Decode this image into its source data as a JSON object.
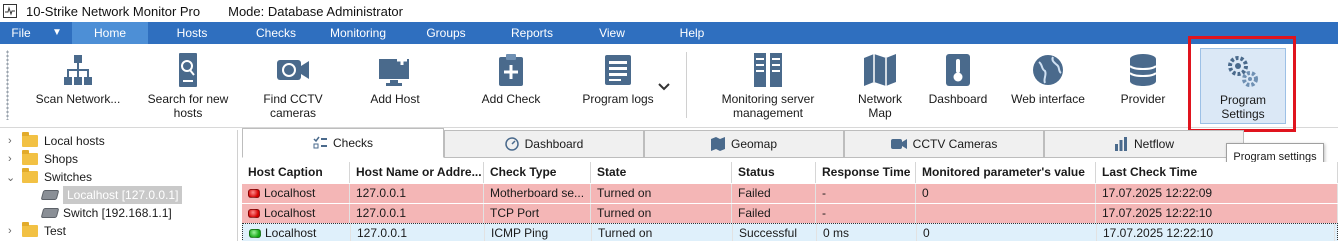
{
  "window": {
    "app_title": "10-Strike Network Monitor Pro",
    "mode_label": "Mode: Database Administrator"
  },
  "menu": {
    "items": [
      "File",
      "Home",
      "Hosts",
      "Checks",
      "Monitoring",
      "Groups",
      "Reports",
      "View",
      "Help"
    ],
    "active": "Home"
  },
  "ribbon": {
    "buttons": [
      {
        "label": "Scan Network...",
        "icon": "network-tree-icon"
      },
      {
        "label": "Search for new hosts",
        "icon": "search-server-icon"
      },
      {
        "label": "Find CCTV cameras",
        "icon": "cctv-camera-icon"
      },
      {
        "label": "Add Host",
        "icon": "add-host-monitor-icon"
      },
      {
        "label": "Add Check",
        "icon": "clipboard-plus-icon"
      },
      {
        "label": "Program logs",
        "icon": "log-list-icon"
      },
      {
        "label": "Monitoring server management",
        "icon": "server-rack-icon"
      },
      {
        "label": "Network Map",
        "icon": "map-icon"
      },
      {
        "label": "Dashboard",
        "icon": "thermometer-icon"
      },
      {
        "label": "Web interface",
        "icon": "globe-icon"
      },
      {
        "label": "Provider",
        "icon": "database-icon"
      },
      {
        "label": "Program Settings",
        "icon": "gears-icon"
      }
    ],
    "colors": {
      "icon_primary": "#4a6a8c",
      "icon_secondary": "#6f90b3",
      "highlight_border": "#e0141e"
    }
  },
  "tooltip": {
    "text": "Program settings"
  },
  "tree": {
    "nodes": [
      {
        "label": "Local hosts",
        "type": "folder"
      },
      {
        "label": "Shops",
        "type": "folder"
      },
      {
        "label": "Switches",
        "type": "folder"
      },
      {
        "label": "Localhost [127.0.0.1]",
        "type": "device",
        "selected": true
      },
      {
        "label": "Switch [192.168.1.1]",
        "type": "device"
      },
      {
        "label": "Test",
        "type": "folder"
      }
    ]
  },
  "tabs": {
    "items": [
      {
        "label": "Checks",
        "icon": "checklist-icon"
      },
      {
        "label": "Dashboard",
        "icon": "gauge-icon"
      },
      {
        "label": "Geomap",
        "icon": "geomap-icon"
      },
      {
        "label": "CCTV Cameras",
        "icon": "video-camera-icon"
      },
      {
        "label": "Netflow",
        "icon": "bar-chart-icon"
      }
    ],
    "active": "Checks"
  },
  "grid": {
    "columns": [
      "Host Caption",
      "Host Name or Addre...",
      "Check Type",
      "State",
      "Status",
      "Response Time",
      "Monitored parameter's value",
      "Last Check Time"
    ],
    "rows": [
      {
        "led": "red",
        "cells": [
          "Localhost",
          "127.0.0.1",
          "Motherboard se...",
          "Turned on",
          "Failed",
          "-",
          "0",
          "17.07.2025 12:22:09"
        ]
      },
      {
        "led": "red",
        "cells": [
          "Localhost",
          "127.0.0.1",
          "TCP Port",
          "Turned on",
          "Failed",
          "-",
          "",
          "17.07.2025 12:22:10"
        ]
      },
      {
        "led": "green",
        "cells": [
          "Localhost",
          "127.0.0.1",
          "ICMP Ping",
          "Turned on",
          "Successful",
          "0 ms",
          "0",
          "17.07.2025 12:22:10"
        ]
      }
    ],
    "colors": {
      "failed_row": "#f4b6b6",
      "ok_row": "#dff0fb"
    }
  }
}
